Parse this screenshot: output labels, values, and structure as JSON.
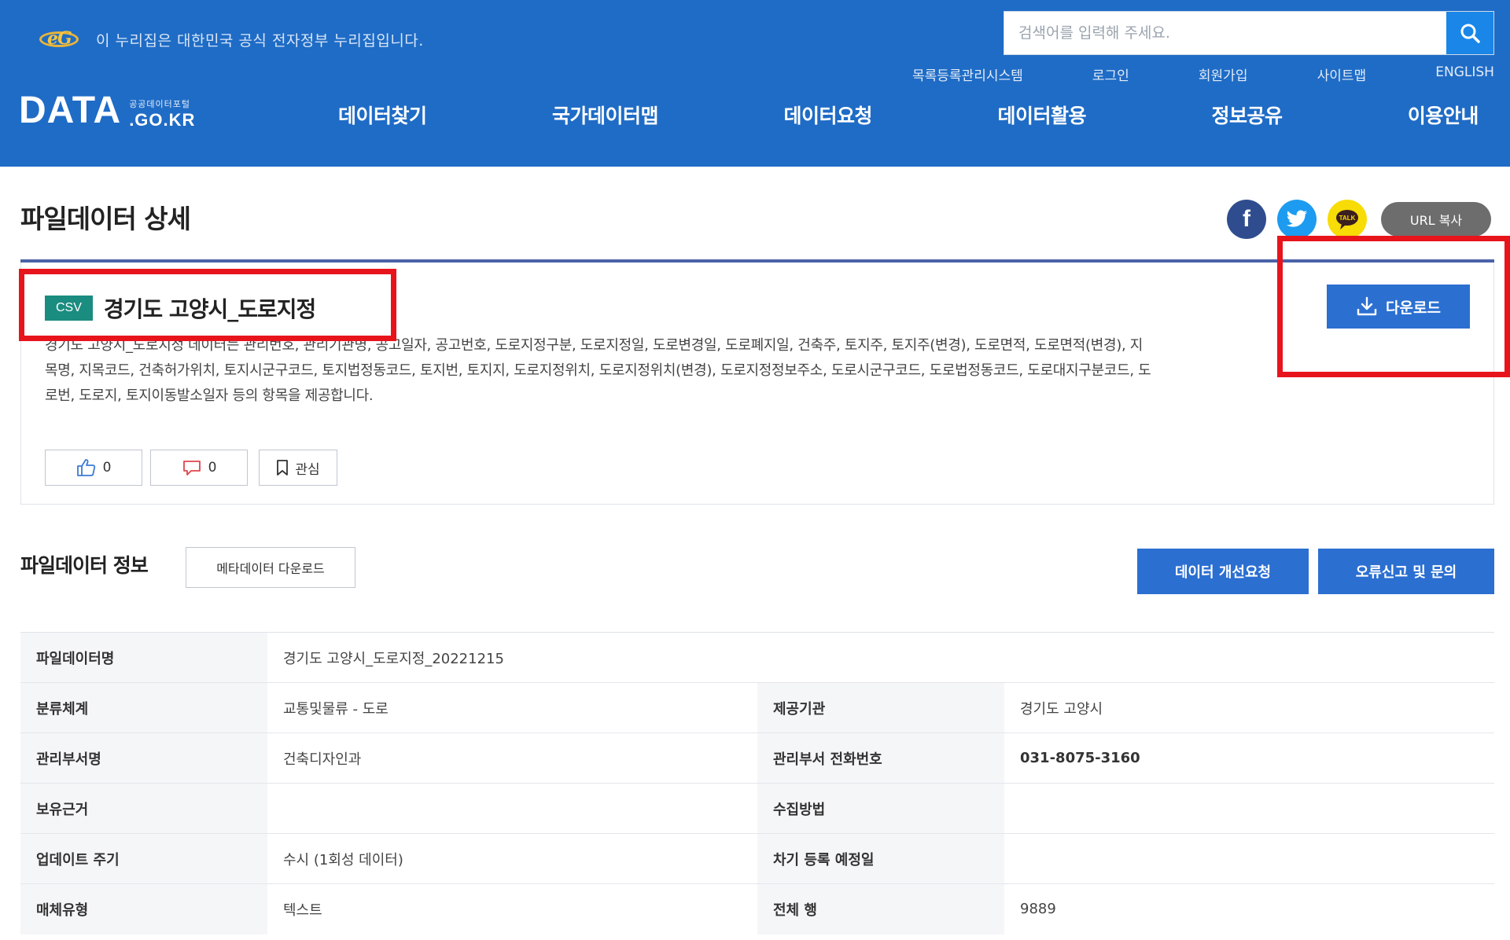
{
  "header": {
    "gov_notice": "이 누리집은 대한민국 공식 전자정부 누리집입니다.",
    "eg_logo_text": "eG",
    "search_placeholder": "검색어를 입력해 주세요.",
    "util_links": [
      "목록등록관리시스템",
      "로그인",
      "회원가입",
      "사이트맵",
      "ENGLISH"
    ],
    "logo_main": "DATA",
    "logo_sub_kor": "공공데이터포털",
    "logo_sub_domain": ".GO.KR",
    "nav": [
      "데이터찾기",
      "국가데이터맵",
      "데이터요청",
      "데이터활용",
      "정보공유",
      "이용안내"
    ],
    "colors": {
      "header_bg": "#1f6cc6",
      "accent_button": "#2b6fd1",
      "highlight": "#e8141c"
    }
  },
  "page": {
    "title": "파일데이터 상세",
    "share": {
      "facebook_icon": "facebook-icon",
      "twitter_icon": "twitter-icon",
      "kakao_icon": "kakaotalk-icon",
      "url_copy": "URL 복사"
    }
  },
  "dataset": {
    "format": "CSV",
    "title": "경기도 고양시_도로지정",
    "description": "경기도 고양시_도로지정 데이터는 관리번호, 관리기관명, 공고일자, 공고번호, 도로지정구분, 도로지정일, 도로변경일, 도로폐지일, 건축주, 토지주, 토지주(변경), 도로면적, 도로면적(변경), 지목명, 지목코드, 건축허가위치, 토지시군구코드, 토지법정동코드, 토지번, 토지지, 도로지정위치, 도로지정위치(변경), 도로지정정보주소, 도로시군구코드, 도로법정동코드, 도로대지구분코드, 도로번, 도로지, 토지이동발소일자 등의 항목을 제공합니다.",
    "likes": "0",
    "dislikes": "0",
    "favorite_label": "관심",
    "download_label": "다운로드"
  },
  "file_info": {
    "section_title": "파일데이터 정보",
    "metadata_download": "메타데이터 다운로드",
    "improve_request": "데이터 개선요청",
    "error_report": "오류신고 및 문의",
    "rows": {
      "file_name_label": "파일데이터명",
      "file_name_value": "경기도 고양시_도로지정_20221215",
      "category_label": "분류체계",
      "category_value": "교통및물류 - 도로",
      "provider_label": "제공기관",
      "provider_value": "경기도 고양시",
      "dept_label": "관리부서명",
      "dept_value": "건축디자인과",
      "phone_label": "관리부서 전화번호",
      "phone_value": "031-8075-3160",
      "basis_label": "보유근거",
      "basis_value": "",
      "collect_label": "수집방법",
      "collect_value": "",
      "update_label": "업데이트 주기",
      "update_value": "수시 (1회성 데이터)",
      "next_reg_label": "차기 등록 예정일",
      "next_reg_value": "",
      "media_label": "매체유형",
      "media_value": "텍스트",
      "total_rows_label": "전체 행",
      "total_rows_value": "9889"
    }
  }
}
